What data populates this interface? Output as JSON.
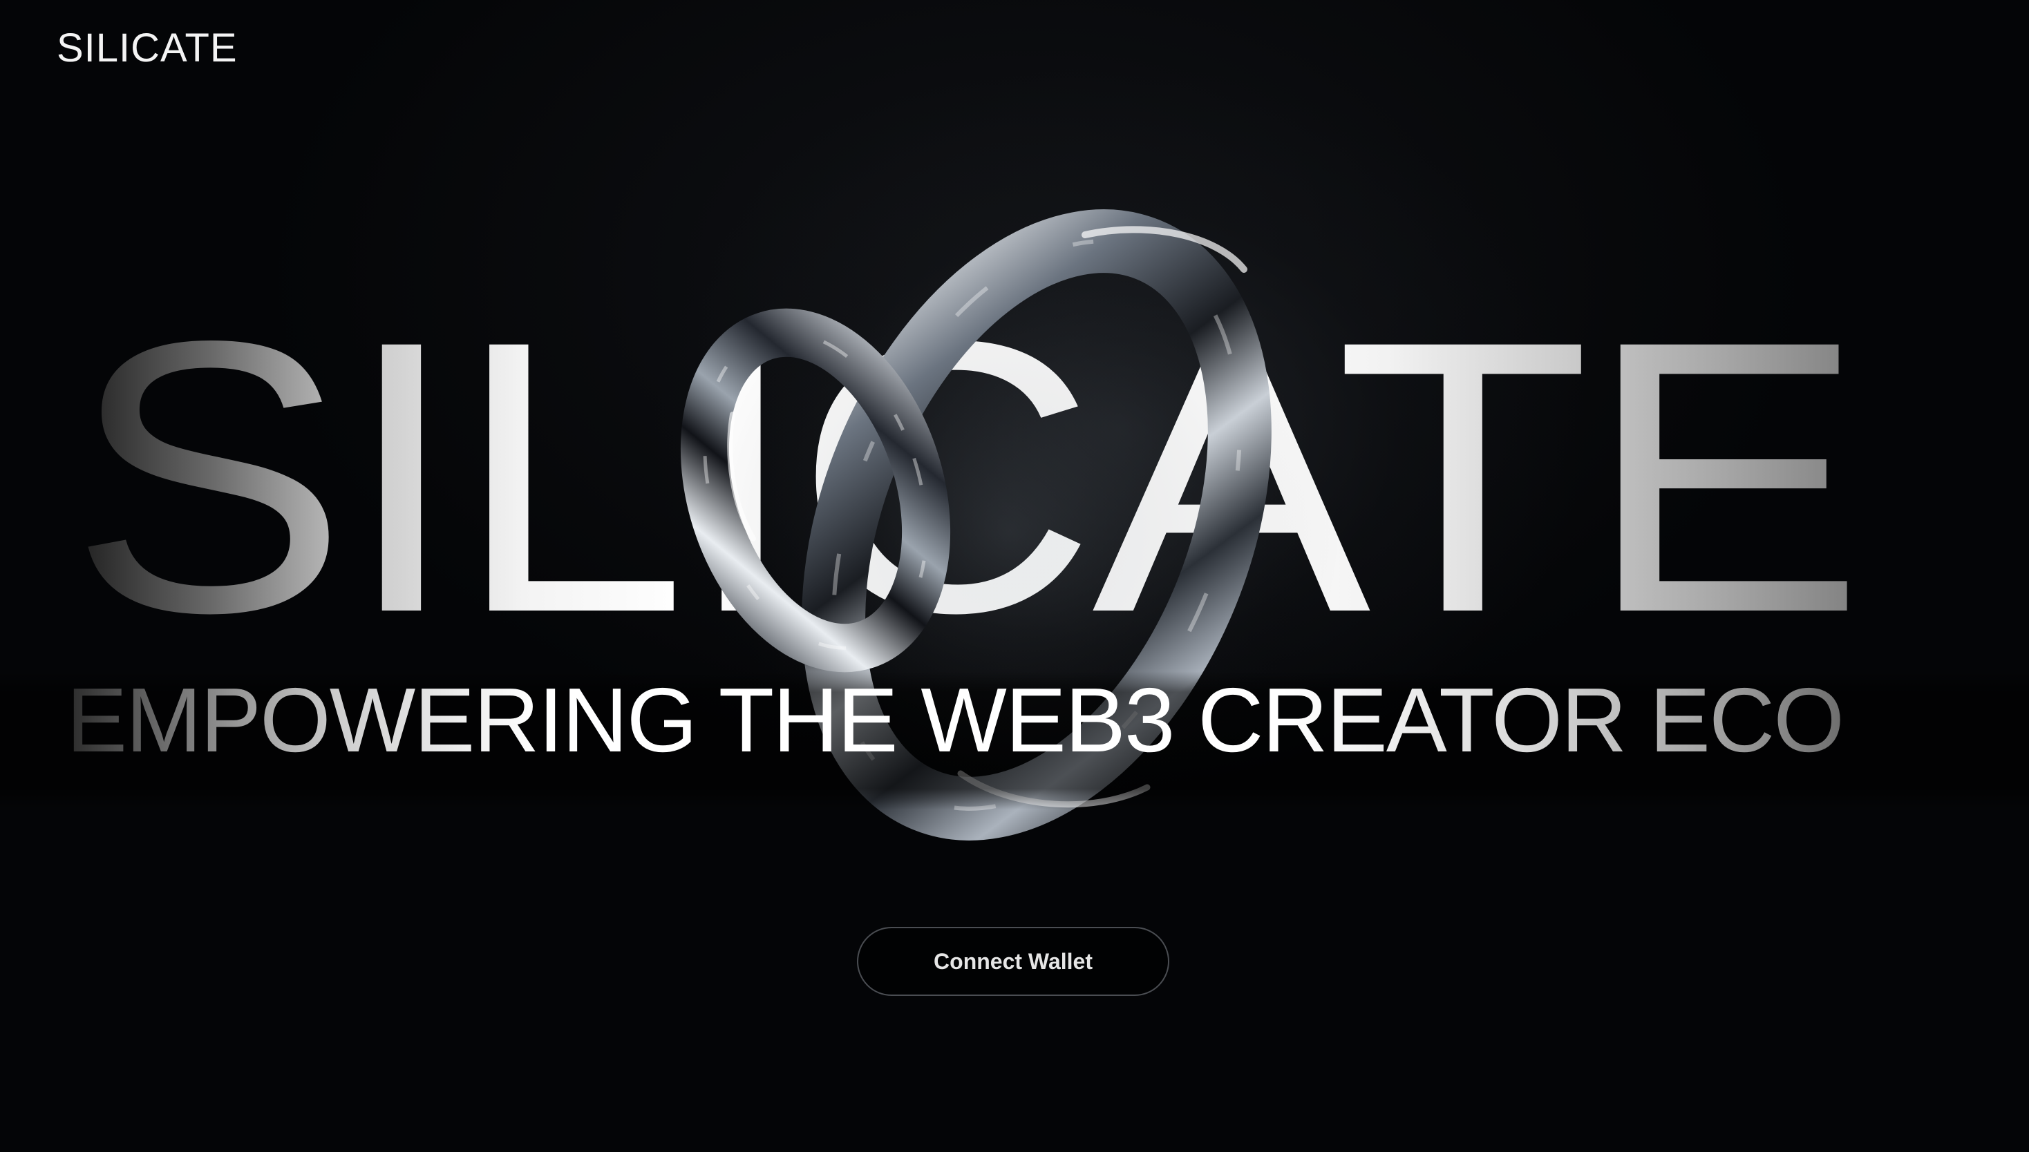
{
  "header": {
    "logo_text": "SILICATE"
  },
  "hero": {
    "title": "SILICATE",
    "tagline": "EMPOWERING THE WEB3 CREATOR ECO",
    "sculpture_icon": "chrome-chain-link-3d-icon"
  },
  "actions": {
    "connect_wallet_label": "Connect Wallet"
  },
  "colors": {
    "background": "#040507",
    "text": "#ffffff",
    "button_border": "#4a4d52",
    "button_text": "#e6e6e6"
  }
}
